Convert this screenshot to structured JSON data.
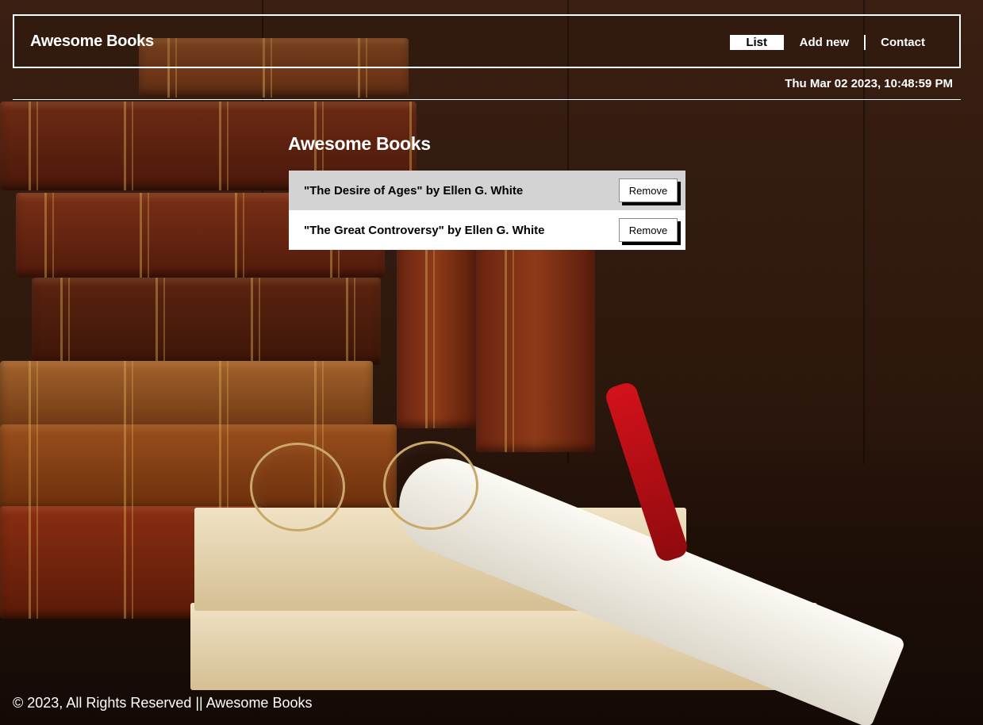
{
  "header": {
    "brand": "Awesome Books",
    "nav": [
      {
        "label": "List",
        "active": true
      },
      {
        "label": "Add new",
        "active": false
      },
      {
        "label": "Contact",
        "active": false
      }
    ],
    "datetime": "Thu Mar 02 2023, 10:48:59 PM"
  },
  "main": {
    "title": "Awesome Books",
    "books": [
      {
        "text": "\"The Desire of Ages\" by Ellen G. White",
        "button": "Remove"
      },
      {
        "text": "\"The Great Controversy\" by Ellen G. White",
        "button": "Remove"
      }
    ]
  },
  "footer": {
    "text": "© 2023, All Rights Reserved || Awesome Books"
  },
  "colors": {
    "accent_text": "#ffffff",
    "row_odd": "#d3d3d3",
    "row_even": "#ffffff"
  }
}
